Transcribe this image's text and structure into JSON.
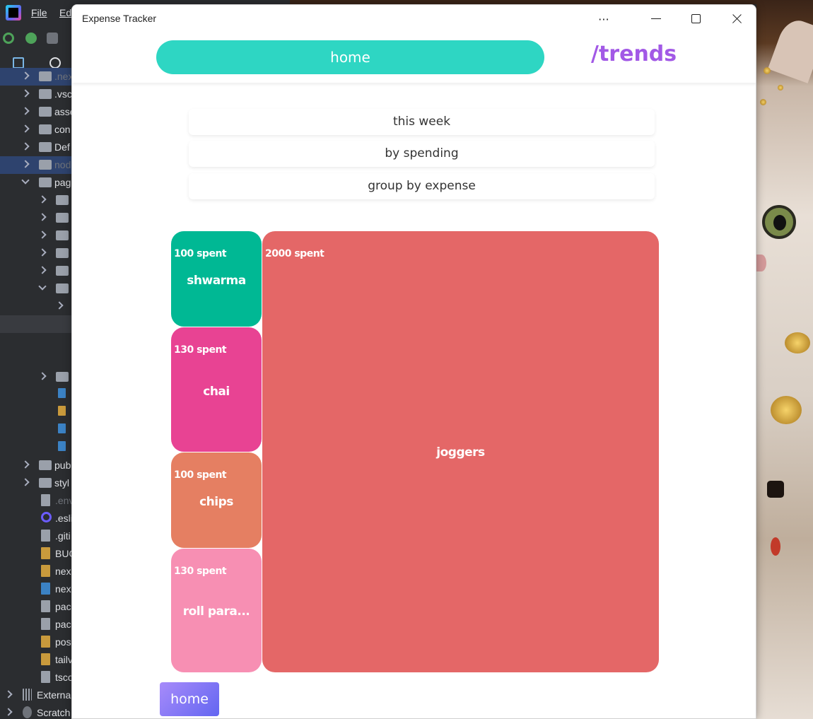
{
  "ide": {
    "menu": [
      "File",
      "Ed"
    ],
    "tree": [
      {
        "label": ".nex",
        "kind": "folder",
        "indent": 0,
        "arrow": "right",
        "dim": true,
        "state": "sel"
      },
      {
        "label": ".vsc",
        "kind": "folder",
        "indent": 0,
        "arrow": "right"
      },
      {
        "label": "asse",
        "kind": "folder",
        "indent": 0,
        "arrow": "right"
      },
      {
        "label": "con",
        "kind": "folder",
        "indent": 0,
        "arrow": "right"
      },
      {
        "label": "Def",
        "kind": "folder",
        "indent": 0,
        "arrow": "right"
      },
      {
        "label": "nod",
        "kind": "folder",
        "indent": 0,
        "arrow": "right",
        "dim": true,
        "state": "sel"
      },
      {
        "label": "pag",
        "kind": "folder",
        "indent": 0,
        "arrow": "down"
      },
      {
        "label": "",
        "kind": "folder",
        "indent": 1,
        "arrow": "right"
      },
      {
        "label": "",
        "kind": "folder",
        "indent": 1,
        "arrow": "right"
      },
      {
        "label": "",
        "kind": "folder",
        "indent": 1,
        "arrow": "right"
      },
      {
        "label": "",
        "kind": "folder",
        "indent": 1,
        "arrow": "right"
      },
      {
        "label": "",
        "kind": "folder",
        "indent": 1,
        "arrow": "right"
      },
      {
        "label": "",
        "kind": "folder",
        "indent": 1,
        "arrow": "down"
      },
      {
        "label": "",
        "kind": "none",
        "indent": 2,
        "arrow": "right"
      },
      {
        "label": "",
        "kind": "none",
        "indent": 0,
        "state": "hover"
      },
      {
        "label": "",
        "kind": "none",
        "indent": 0
      },
      {
        "label": "",
        "kind": "none",
        "indent": 0
      },
      {
        "label": "",
        "kind": "folder",
        "indent": 1,
        "arrow": "right"
      },
      {
        "label": "",
        "kind": "ts",
        "indent": 1,
        "half": true
      },
      {
        "label": "",
        "kind": "js",
        "indent": 1,
        "half": true
      },
      {
        "label": "",
        "kind": "ts",
        "indent": 1,
        "half": true
      },
      {
        "label": "",
        "kind": "ts",
        "indent": 1,
        "half": true
      },
      {
        "label": "pub",
        "kind": "folder",
        "indent": 0,
        "arrow": "right"
      },
      {
        "label": "styl",
        "kind": "folder",
        "indent": 0,
        "arrow": "right"
      },
      {
        "label": ".env",
        "kind": "file",
        "indent": 0,
        "dim": true
      },
      {
        "label": ".esli",
        "kind": "ring",
        "indent": 0
      },
      {
        "label": ".giti",
        "kind": "file",
        "indent": 0
      },
      {
        "label": "BUG",
        "kind": "js",
        "indent": 0
      },
      {
        "label": "nex",
        "kind": "js",
        "indent": 0
      },
      {
        "label": "nex",
        "kind": "ts",
        "indent": 0
      },
      {
        "label": "pac",
        "kind": "file",
        "indent": 0
      },
      {
        "label": "pac",
        "kind": "file",
        "indent": 0
      },
      {
        "label": "pos",
        "kind": "js",
        "indent": 0
      },
      {
        "label": "tailv",
        "kind": "js",
        "indent": 0
      },
      {
        "label": "tsco",
        "kind": "file",
        "indent": 0
      },
      {
        "label": "Externa",
        "kind": "bars",
        "indent": -1,
        "arrow": "right"
      },
      {
        "label": "Scratch",
        "kind": "scratch",
        "indent": -1,
        "arrow": "right"
      }
    ]
  },
  "window": {
    "title": "Expense Tracker",
    "more_glyph": "⋯",
    "close_glyph": "✕"
  },
  "nav": {
    "home_label": "home",
    "trends_label": "/trends"
  },
  "filters": [
    "this week",
    "by spending",
    "group by expense"
  ],
  "expenses": [
    {
      "name": "shwarma",
      "spent_label": "100 spent",
      "amount": 100,
      "color": "#00b894"
    },
    {
      "name": "chai",
      "spent_label": "130 spent",
      "amount": 130,
      "color": "#e84393"
    },
    {
      "name": "chips",
      "spent_label": "100 spent",
      "amount": 100,
      "color": "#e57f62"
    },
    {
      "name": "roll para...",
      "spent_label": "130 spent",
      "amount": 130,
      "color": "#f78fb3"
    },
    {
      "name": "joggers",
      "spent_label": "2000 spent",
      "amount": 2000,
      "color": "#e46767"
    }
  ],
  "footer": {
    "home_label": "home"
  }
}
